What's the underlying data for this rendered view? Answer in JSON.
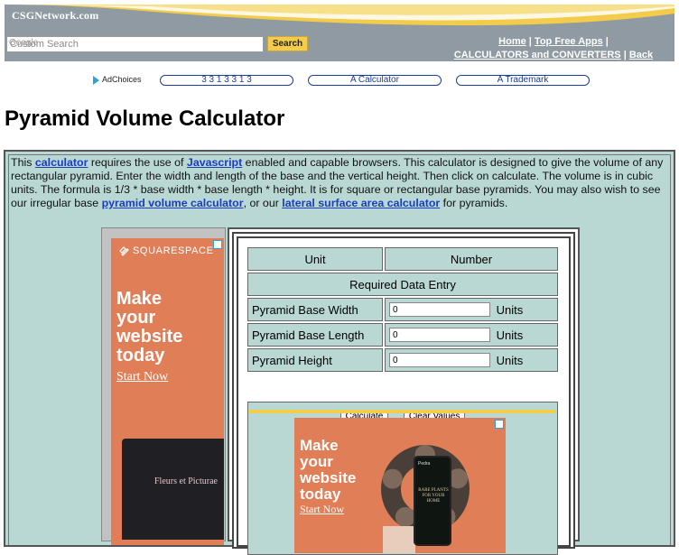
{
  "header": {
    "logo": "CSGNetwork.com",
    "search_placeholder": "Custom Search",
    "search_brand": "Google",
    "search_button": "Search",
    "links": {
      "home": "Home",
      "sep1": "|",
      "top_free_apps": "Top Free Apps",
      "sep2": "|",
      "calculators": "CALCULATORS and CONVERTERS",
      "sep3": "|",
      "back": "Back"
    }
  },
  "adbar": {
    "adchoices": "AdChoices",
    "links": [
      "3 3 1 3 3 1 3",
      "A Calculator",
      "A Trademark"
    ]
  },
  "page_title": "Pyramid Volume Calculator",
  "intro": {
    "p1": "This ",
    "link_calculator": "calculator",
    "p2": " requires the use of ",
    "link_javascript": "Javascript",
    "p3": " enabled and capable browsers. This calculator is designed to give the volume of any rectangular pyramid. Enter the width and length of the base and the vertical height. Then click on calculate. The volume is in cubic units. The formula is 1/3 * base width * base length * height. It is for square or rectangular base pyramids. You may also wish to see our irregular base ",
    "link_pyramid": "pyramid volume calculator",
    "p4": ", or our ",
    "link_lateral": "lateral surface area calculator",
    "p5": " for pyramids."
  },
  "side_ad": {
    "brand": "SQUARESPACE",
    "headline_1": "Make",
    "headline_2": "your",
    "headline_3": "website",
    "headline_4": "today",
    "cta": "Start Now",
    "screen_text": "Fleurs et Picturae"
  },
  "calculator": {
    "col_unit": "Unit",
    "col_number": "Number",
    "section": "Required Data Entry",
    "rows": [
      {
        "label": "Pyramid Base Width",
        "value": "0",
        "unit": "Units"
      },
      {
        "label": "Pyramid Base Length",
        "value": "0",
        "unit": "Units"
      },
      {
        "label": "Pyramid Height",
        "value": "0",
        "unit": "Units"
      }
    ],
    "calculate_button": "Calculate",
    "clear_button": "Clear Values"
  },
  "inner_ad": {
    "headline_1": "Make",
    "headline_2": "your",
    "headline_3": "website",
    "headline_4": "today",
    "cta": "Start Now",
    "tablet_brand": "Pedra",
    "tablet_text": "RARE PLANTS FOR YOUR HOME"
  },
  "colors": {
    "header_bg": "#8f9aa3",
    "accent_yellow": "#f2cc4a",
    "panel_bg": "#b9d8d3",
    "link_blue": "#1a3dbf",
    "ad_orange": "#e07f57"
  }
}
